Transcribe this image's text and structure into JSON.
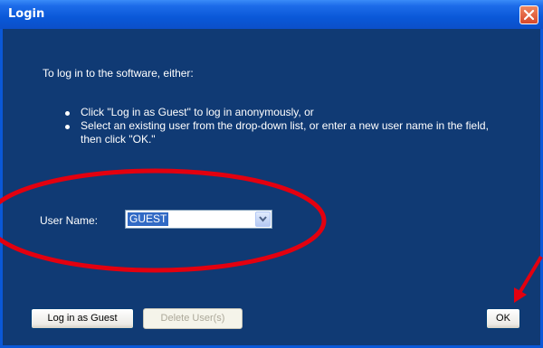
{
  "window": {
    "title": "Login"
  },
  "instructions": {
    "intro": "To log in to the software, either:",
    "bullets": [
      "Click \"Log in as Guest\" to log in anonymously, or",
      "Select an existing user from the drop-down list, or enter a new user name in the field, then click \"OK.\""
    ]
  },
  "user_field": {
    "label": "User Name:",
    "value": "GUEST"
  },
  "buttons": {
    "guest_label": "Log in as Guest",
    "delete_label": "Delete User(s)",
    "ok_label": "OK"
  },
  "colors": {
    "title_bar": "#0a58d8",
    "client_background": "#103a74",
    "close_button": "#d6472a",
    "annotation": "#e3000f",
    "selection": "#316ac5"
  },
  "icons": {
    "close": "close-icon",
    "dropdown": "chevron-down-icon"
  }
}
